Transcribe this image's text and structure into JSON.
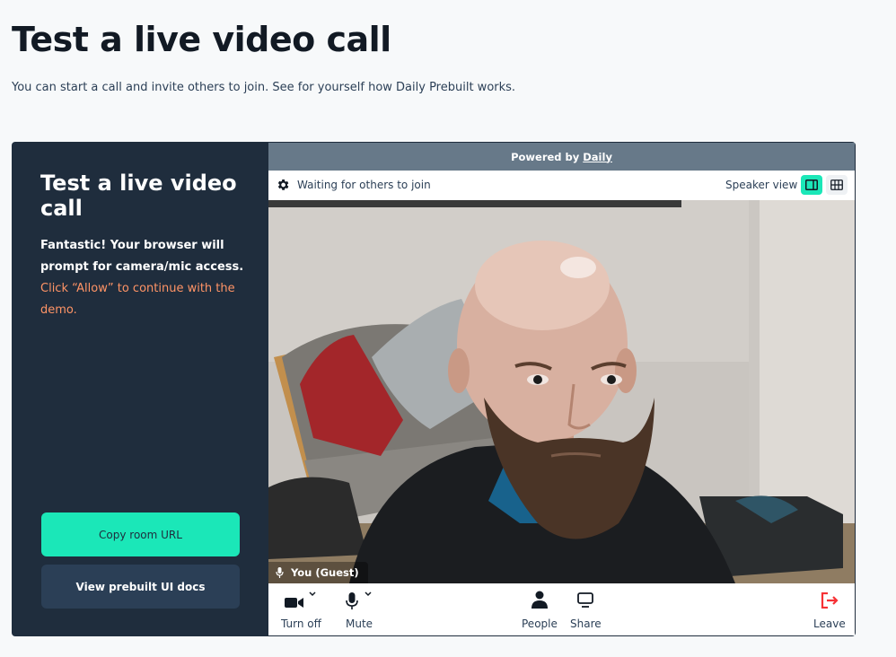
{
  "page": {
    "title": "Test a live video call",
    "subtitle": "You can start a call and invite others to join. See for yourself how Daily Prebuilt works."
  },
  "side_panel": {
    "title": "Test a live video call",
    "message_bold": "Fantastic! Your browser will prompt for camera/mic access.",
    "message_accent": "Click “Allow” to continue with the demo.",
    "copy_button_label": "Copy room URL",
    "docs_button_label": "View prebuilt UI docs"
  },
  "call": {
    "powered_by_prefix": "Powered by",
    "powered_by_link": "Daily",
    "status": "Waiting for others to join",
    "view_label": "Speaker view",
    "participant_name": "You (Guest)",
    "controls": {
      "camera": "Turn off",
      "mic": "Mute",
      "people": "People",
      "share": "Share",
      "leave": "Leave"
    }
  },
  "colors": {
    "panel_bg": "#1f2d3d",
    "accent_teal": "#1be7b8",
    "accent_orange": "#ff9466",
    "powered_bar": "#677989",
    "leave_red": "#f63135"
  }
}
